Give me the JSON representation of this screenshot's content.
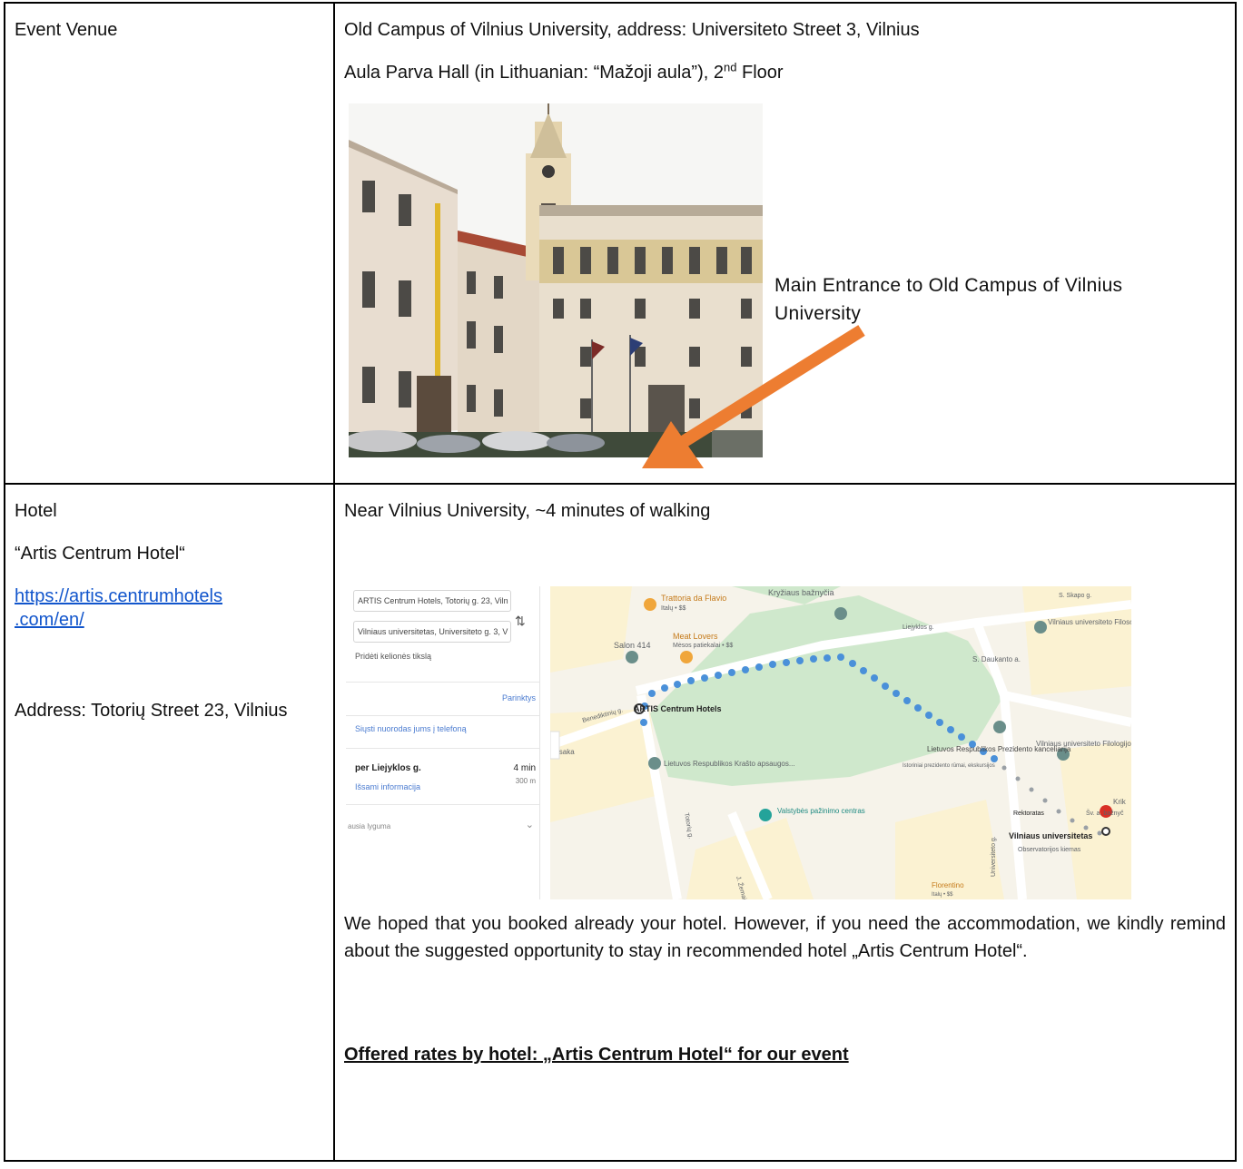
{
  "venue": {
    "label": "Event Venue",
    "line1": "Old Campus of Vilnius University, address: Universiteto Street 3, Vilnius",
    "line2_pre": "Aula Parva Hall (in Lithuanian: “Mažoji aula”), 2",
    "line2_sup": "nd",
    "line2_post": " Floor",
    "photo_caption": "Main Entrance to Old Campus of Vilnius University",
    "arrow_color": "#ed7d31"
  },
  "hotel": {
    "label": "Hotel",
    "name": "“Artis Centrum Hotel“",
    "link_line1": "https://artis.centrumhotels",
    "link_line2": ".com/en/",
    "address": "Address: Totorių Street 23, Vilnius",
    "walk_note": "Near Vilnius University, ~4 minutes of walking",
    "body_text": "We hoped that you booked already your hotel. However, if you need the accommodation, we kindly remind about the suggested opportunity to stay in recommended hotel „Artis Centrum Hotel“.",
    "rates_heading": "Offered rates by hotel: „Artis Centrum Hotel“ for our event",
    "link_color": "#1155cc"
  },
  "map": {
    "from": "ARTIS Centrum Hotels, Totorių g. 23, Viln",
    "to": "Vilniaus universitetas, Universiteto g. 3, V",
    "add_dest": "Pridėti kelionės tikslą",
    "options": "Parinktys",
    "send": "Siųsti nuorodas jums į telefoną",
    "via": "per Liejyklos g.",
    "time": "4 min",
    "dist": "300 m",
    "details": "Išsami informacija",
    "bottom": "ausia lyguma",
    "places": {
      "trattoria": "Trattoria da Flavio",
      "trattoria_sub": "Italų • $$",
      "kryziaus": "Kryžiaus bažnyčia",
      "meat": "Meat Lovers",
      "meat_sub": "Mėsos patiekalai • $$",
      "salon": "Salon 414",
      "hotel": "ARTIS Centrum Hotels",
      "liejyklos": "Liejyklos g.",
      "skapo": "S. Skapo g.",
      "daukanto": "S. Daukanto a.",
      "filosofijos": "Vilniaus universiteto Filosofijos fakultetas",
      "filologijos": "Vilniaus universiteto Filologijos fakultetas",
      "prezidentura": "Lietuvos Respublikos Prezidento kanceliarija",
      "prezidentura_sub": "Istoriniai prezidento rūmai, ekskursijos",
      "krasto": "Lietuvos Respublikos Krašto apsaugos...",
      "valstybes": "Valstybės pažinimo centras",
      "vu": "Vilniaus universitetas",
      "observatorijos": "Observatorijos kiemas",
      "rektoratas": "Rektoratas",
      "benediktinu": "Benediktinių g.",
      "totoriu": "Totorių g.",
      "universiteto": "Universiteto g.",
      "zemaitijos": "J. Žemaitijos g.",
      "florentino": "Florentino",
      "florentino_sub": "Italų • $$",
      "krik": "Krik",
      "isaka": "isaka",
      "bazn": "Šv. a. bažnyč"
    }
  }
}
